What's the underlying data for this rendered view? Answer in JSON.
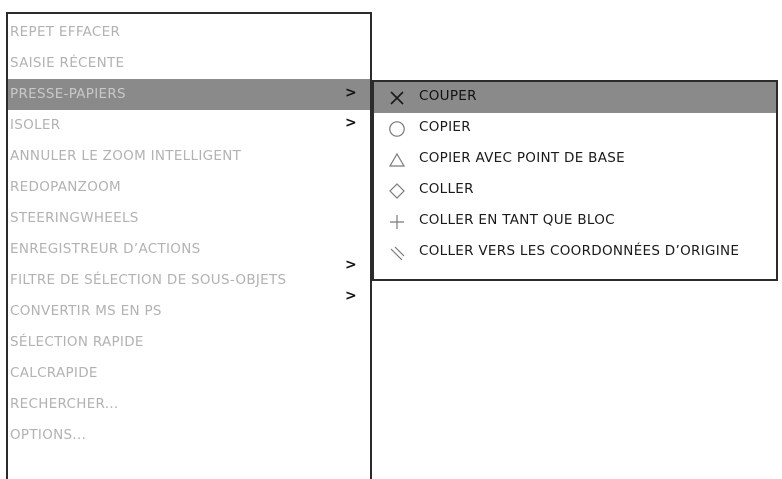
{
  "menu": {
    "items": [
      {
        "label": "REPET EFFACER"
      },
      {
        "label": "SAISIE RÉCENTE"
      },
      {
        "label": "PRESSE-PAPIERS"
      },
      {
        "label": "ISOLER"
      },
      {
        "label": "ANNULER LE ZOOM INTELLIGENT"
      },
      {
        "label": "REDOPANZOOM"
      },
      {
        "label": "STEERINGWHEELS"
      },
      {
        "label": "ENREGISTREUR D’ACTIONS"
      },
      {
        "label": "FILTRE DE SÉLECTION DE SOUS-OBJETS"
      },
      {
        "label": "CONVERTIR MS EN PS"
      },
      {
        "label": "SÉLECTION RAPIDE"
      },
      {
        "label": "CALCRAPIDE"
      },
      {
        "label": "RECHERCHER..."
      },
      {
        "label": "OPTIONS..."
      }
    ],
    "chevron": ">",
    "active_item": "PRESSE-PAPIERS"
  },
  "submenu": {
    "items": [
      {
        "label": "COUPER",
        "icon": "cut-icon"
      },
      {
        "label": "COPIER",
        "icon": "circle-icon"
      },
      {
        "label": "COPIER AVEC POINT DE BASE",
        "icon": "triangle-icon"
      },
      {
        "label": "COLLER",
        "icon": "diamond-icon"
      },
      {
        "label": "COLLER EN TANT QUE BLOC",
        "icon": "plus-icon"
      },
      {
        "label": "COLLER VERS LES COORDONNÉES D’ORIGINE",
        "icon": "hatch-icon"
      }
    ],
    "active_item": "COUPER"
  },
  "colors": {
    "highlight": "#8a8a8a",
    "disabled_text": "#b2b2b2",
    "enabled_text": "#1a1a1a",
    "border": "#2b2b2b"
  }
}
